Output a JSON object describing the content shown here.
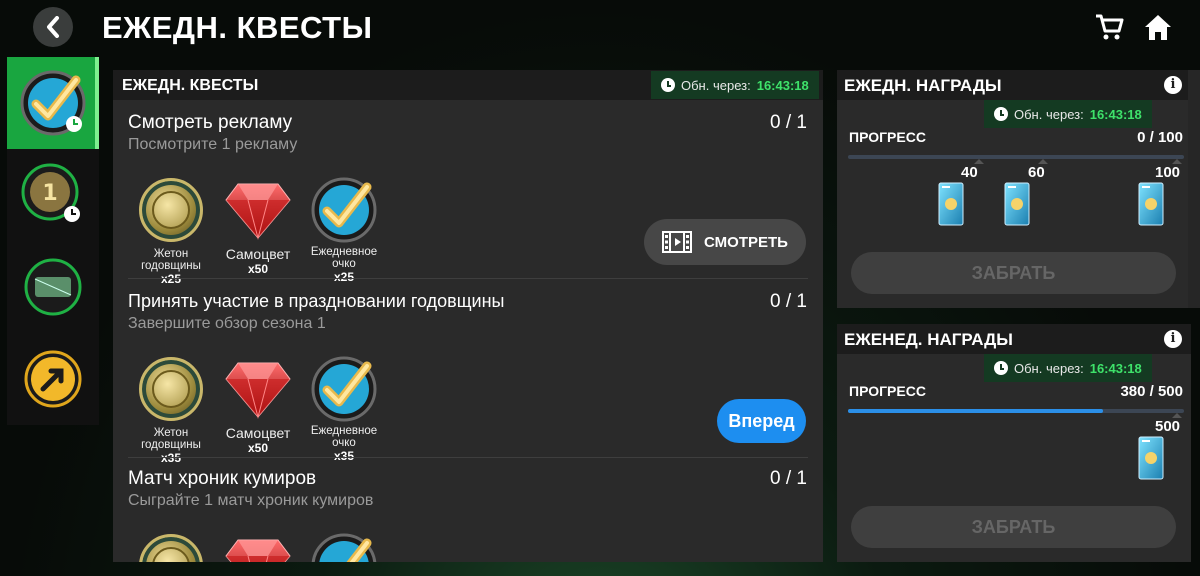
{
  "header": {
    "title": "ЕЖЕДН. КВЕСТЫ",
    "back_icon": "chevron-left-icon",
    "cart_icon": "cart-icon",
    "home_icon": "home-icon"
  },
  "sidebar": {
    "items": [
      {
        "name": "daily-quests",
        "icon": "check-badge-clock-icon",
        "active": true
      },
      {
        "name": "anniversary-tokens",
        "icon": "token-clock-icon",
        "active": false
      },
      {
        "name": "pitch",
        "icon": "pitch-icon",
        "active": false
      },
      {
        "name": "arrow",
        "icon": "arrow-up-right-icon",
        "active": false
      }
    ]
  },
  "main": {
    "title": "ЕЖЕДН. КВЕСТЫ",
    "timer_label": "Обн. через:",
    "timer_value": "16:43:18",
    "quests": [
      {
        "title": "Смотреть рекламу",
        "desc": "Посмотрите 1 рекламу",
        "count": "0 / 1",
        "rewards": [
          {
            "name": "Жетон годовщины",
            "qty": "x25",
            "icon": "anniversary-token-icon"
          },
          {
            "name": "Самоцвет",
            "qty": "x50",
            "icon": "gem-icon"
          },
          {
            "name": "Ежедневное очко",
            "qty": "x25",
            "icon": "daily-point-icon"
          }
        ],
        "action": "СМОТРЕТЬ"
      },
      {
        "title": "Принять участие в праздновании годовщины",
        "desc": "Завершите обзор сезона 1",
        "count": "0 / 1",
        "rewards": [
          {
            "name": "Жетон годовщины",
            "qty": "x35",
            "icon": "anniversary-token-icon"
          },
          {
            "name": "Самоцвет",
            "qty": "x50",
            "icon": "gem-icon"
          },
          {
            "name": "Ежедневное очко",
            "qty": "x35",
            "icon": "daily-point-icon"
          }
        ],
        "action": "Вперед"
      },
      {
        "title": "Матч хроник кумиров",
        "desc": "Сыграйте 1 матч хроник кумиров",
        "count": "0 / 1"
      }
    ]
  },
  "daily_rewards": {
    "title": "ЕЖЕДН. НАГРАДЫ",
    "timer_label": "Обн. через:",
    "timer_value": "16:43:18",
    "progress_label": "ПРОГРЕСС",
    "progress_value": "0 / 100",
    "progress_fraction": 0,
    "milestones": [
      "40",
      "60",
      "100"
    ],
    "claim_label": "ЗАБРАТЬ"
  },
  "weekly_rewards": {
    "title": "ЕЖЕНЕД. НАГРАДЫ",
    "timer_label": "Обн. через:",
    "timer_value": "16:43:18",
    "progress_label": "ПРОГРЕСС",
    "progress_value": "380 / 500",
    "progress_fraction": 0.76,
    "milestones": [
      "500"
    ],
    "claim_label": "ЗАБРАТЬ"
  },
  "colors": {
    "accent_green": "#19a640",
    "timer_green": "#3ee26a",
    "button_blue": "#1d8ef0",
    "progress_blue": "#2b8fe8"
  }
}
